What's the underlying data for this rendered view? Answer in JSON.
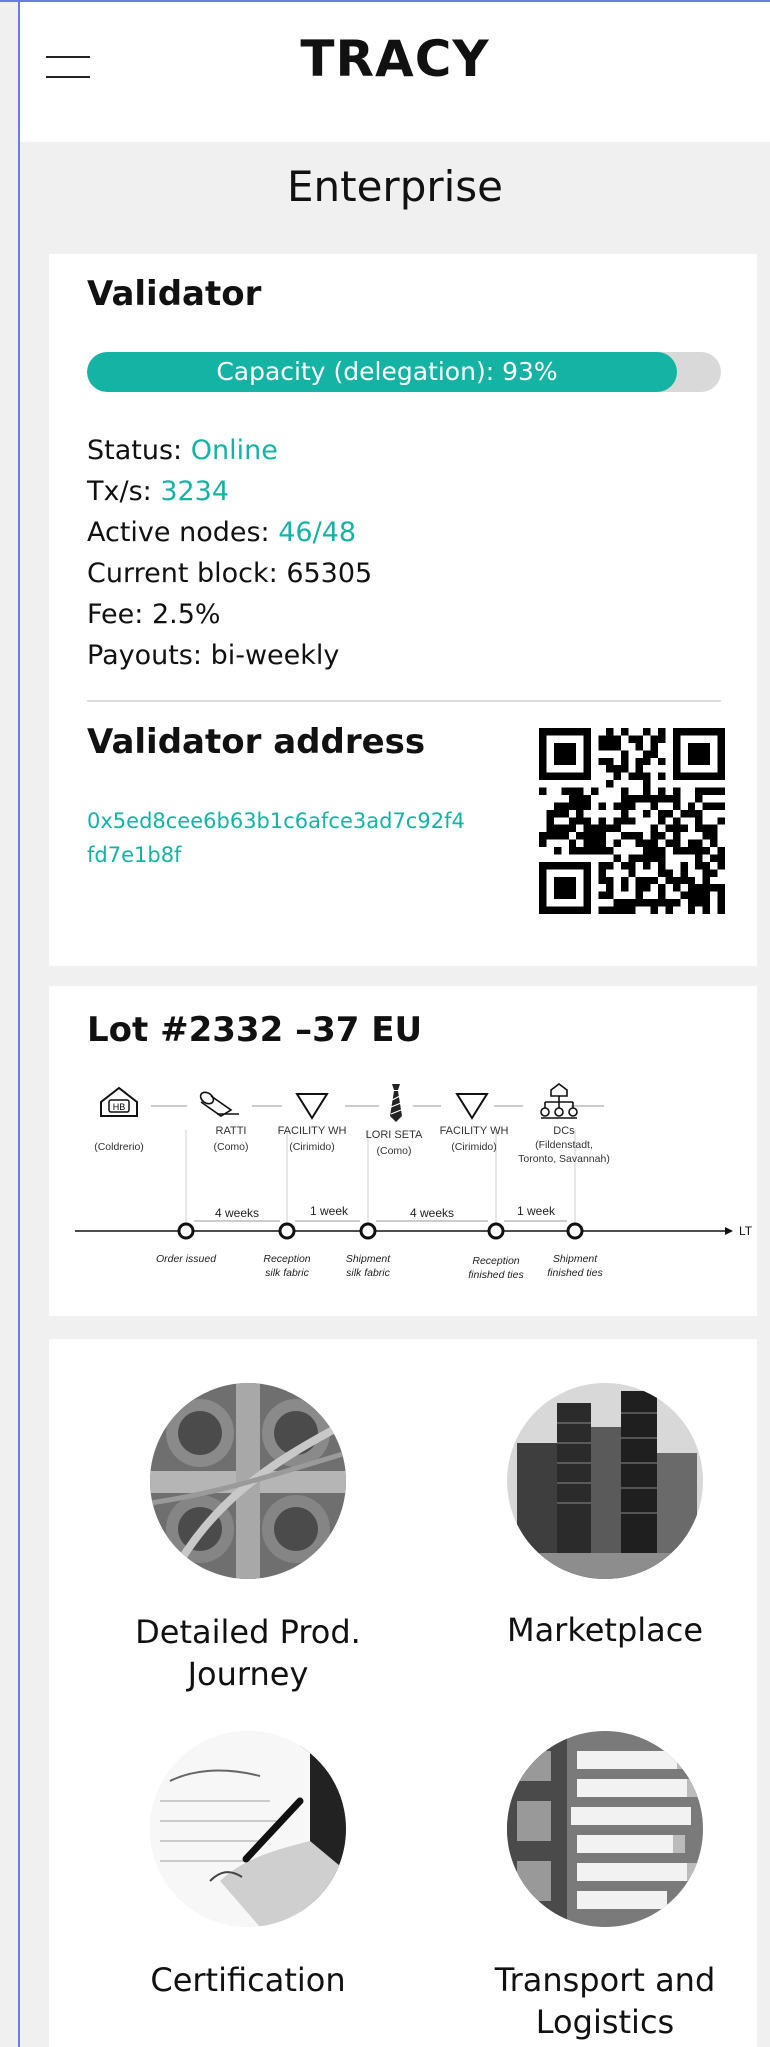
{
  "header": {
    "logo": "TRACY",
    "menu_icon": "hamburger-menu-icon"
  },
  "page_title": "Enterprise",
  "validator": {
    "title": "Validator",
    "capacity": {
      "label": "Capacity (delegation): 93%",
      "percent": 93
    },
    "stats": [
      {
        "label": "Status: ",
        "value": "Online",
        "highlight": true
      },
      {
        "label": "Tx/s: ",
        "value": "3234",
        "highlight": true
      },
      {
        "label": "Active nodes: ",
        "value": "46/48",
        "highlight": true
      },
      {
        "label": "Current block: ",
        "value": "65305",
        "highlight": false
      },
      {
        "label": "Fee: ",
        "value": "2.5%",
        "highlight": false
      },
      {
        "label": "Payouts: ",
        "value": "bi-weekly",
        "highlight": false
      }
    ],
    "address_title": "Validator address",
    "address": "0x5ed8cee6b63b1c6afce3ad7c92f4fd7e1b8f",
    "accent_color": "#14b3a3"
  },
  "lot": {
    "title": "Lot #2332 –37 EU",
    "hb_badge": "HB",
    "stations": [
      {
        "name": "",
        "sub": "(Coldrerio)",
        "icon": "house-icon"
      },
      {
        "name": "RATTI",
        "sub": "(Como)",
        "icon": "fabric-roll-icon"
      },
      {
        "name": "FACILITY WH",
        "sub": "(Cirimido)",
        "icon": "triangle-warehouse-icon"
      },
      {
        "name": "LORI SETA",
        "sub": "(Como)",
        "icon": "tie-icon"
      },
      {
        "name": "FACILITY WH",
        "sub": "(Cirimido)",
        "icon": "triangle-warehouse-icon"
      },
      {
        "name": "DCs",
        "sub": "(Fildenstadt,",
        "sub2": "Toronto, Savannah)",
        "icon": "network-icon"
      }
    ],
    "durations": [
      "4 weeks",
      "1 week",
      "4 weeks",
      "1 week"
    ],
    "milestones": [
      {
        "line1": "Order issued",
        "line2": ""
      },
      {
        "line1": "Reception",
        "line2": "silk fabric"
      },
      {
        "line1": "Shipment",
        "line2": "silk fabric"
      },
      {
        "line1": "Reception",
        "line2": "finished ties"
      },
      {
        "line1": "Shipment",
        "line2": "finished ties"
      }
    ],
    "axis_label": "LT"
  },
  "tiles": [
    {
      "label_line1": "Detailed Prod.",
      "label_line2": "Journey",
      "icon": "highway-interchange-image"
    },
    {
      "label_line1": "Marketplace",
      "label_line2": "",
      "icon": "city-buildings-image"
    },
    {
      "label_line1": "Certification",
      "label_line2": "",
      "icon": "signing-document-image"
    },
    {
      "label_line1": "Transport and",
      "label_line2": "Logistics",
      "icon": "trucks-aerial-image"
    }
  ]
}
